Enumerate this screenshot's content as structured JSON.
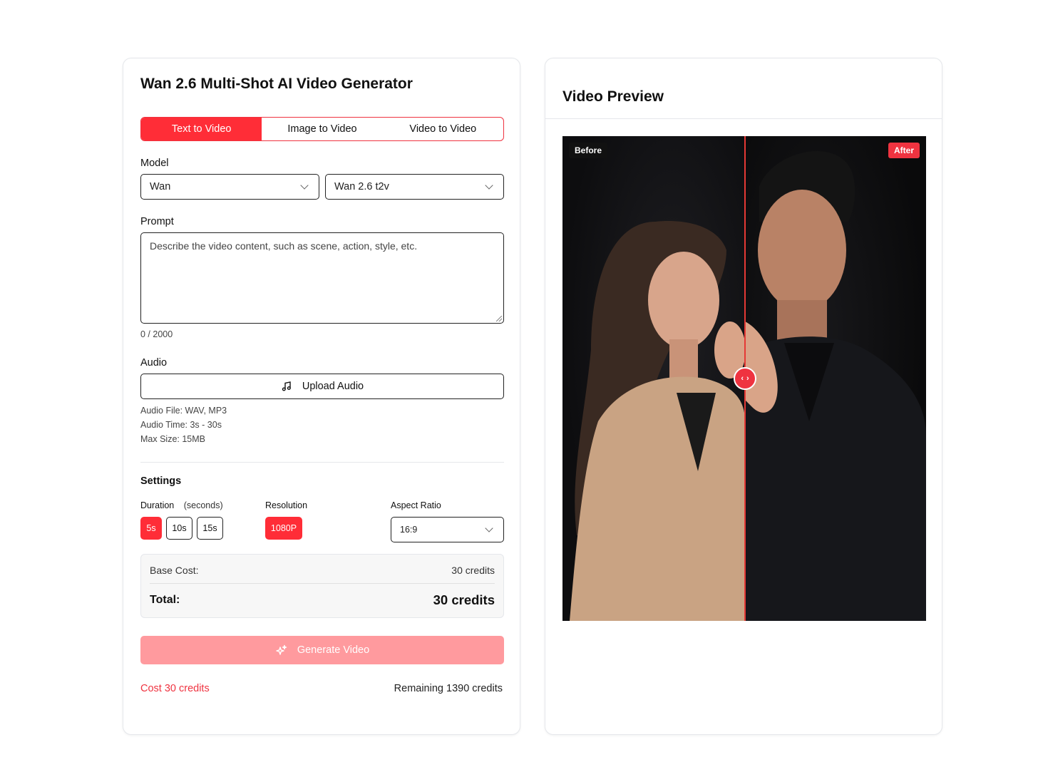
{
  "generator": {
    "title": "Wan 2.6 Multi-Shot AI Video Generator",
    "tabs": [
      {
        "label": "Text to Video",
        "active": true
      },
      {
        "label": "Image to Video",
        "active": false
      },
      {
        "label": "Video to Video",
        "active": false
      }
    ],
    "model": {
      "label": "Model",
      "provider": "Wan",
      "version": "Wan 2.6 t2v"
    },
    "prompt": {
      "label": "Prompt",
      "placeholder": "Describe the video content, such as scene, action, style, etc.",
      "value": "",
      "counter": "0 / 2000"
    },
    "audio": {
      "label": "Audio",
      "upload_label": "Upload Audio",
      "file_info": "Audio File: WAV, MP3",
      "time_info": "Audio Time: 3s - 30s",
      "size_info": "Max Size: 15MB"
    },
    "settings": {
      "title": "Settings",
      "duration_label": "Duration",
      "duration_unit": "(seconds)",
      "durations": [
        {
          "label": "5s",
          "active": true
        },
        {
          "label": "10s",
          "active": false
        },
        {
          "label": "15s",
          "active": false
        }
      ],
      "resolution_label": "Resolution",
      "resolution": "1080P",
      "aspect_label": "Aspect Ratio",
      "aspect_value": "16:9"
    },
    "cost": {
      "base_label": "Base Cost:",
      "base_value": "30 credits",
      "total_label": "Total:",
      "total_value": "30 credits"
    },
    "generate_label": "Generate Video",
    "footer": {
      "cost_text": "Cost 30 credits",
      "remaining_text": "Remaining 1390 credits"
    }
  },
  "preview": {
    "title": "Video Preview",
    "before_label": "Before",
    "after_label": "After",
    "slider_position": 0.5
  },
  "colors": {
    "accent": "#ff2d37",
    "accent_disabled": "#ff9a9e",
    "text": "#111111"
  }
}
